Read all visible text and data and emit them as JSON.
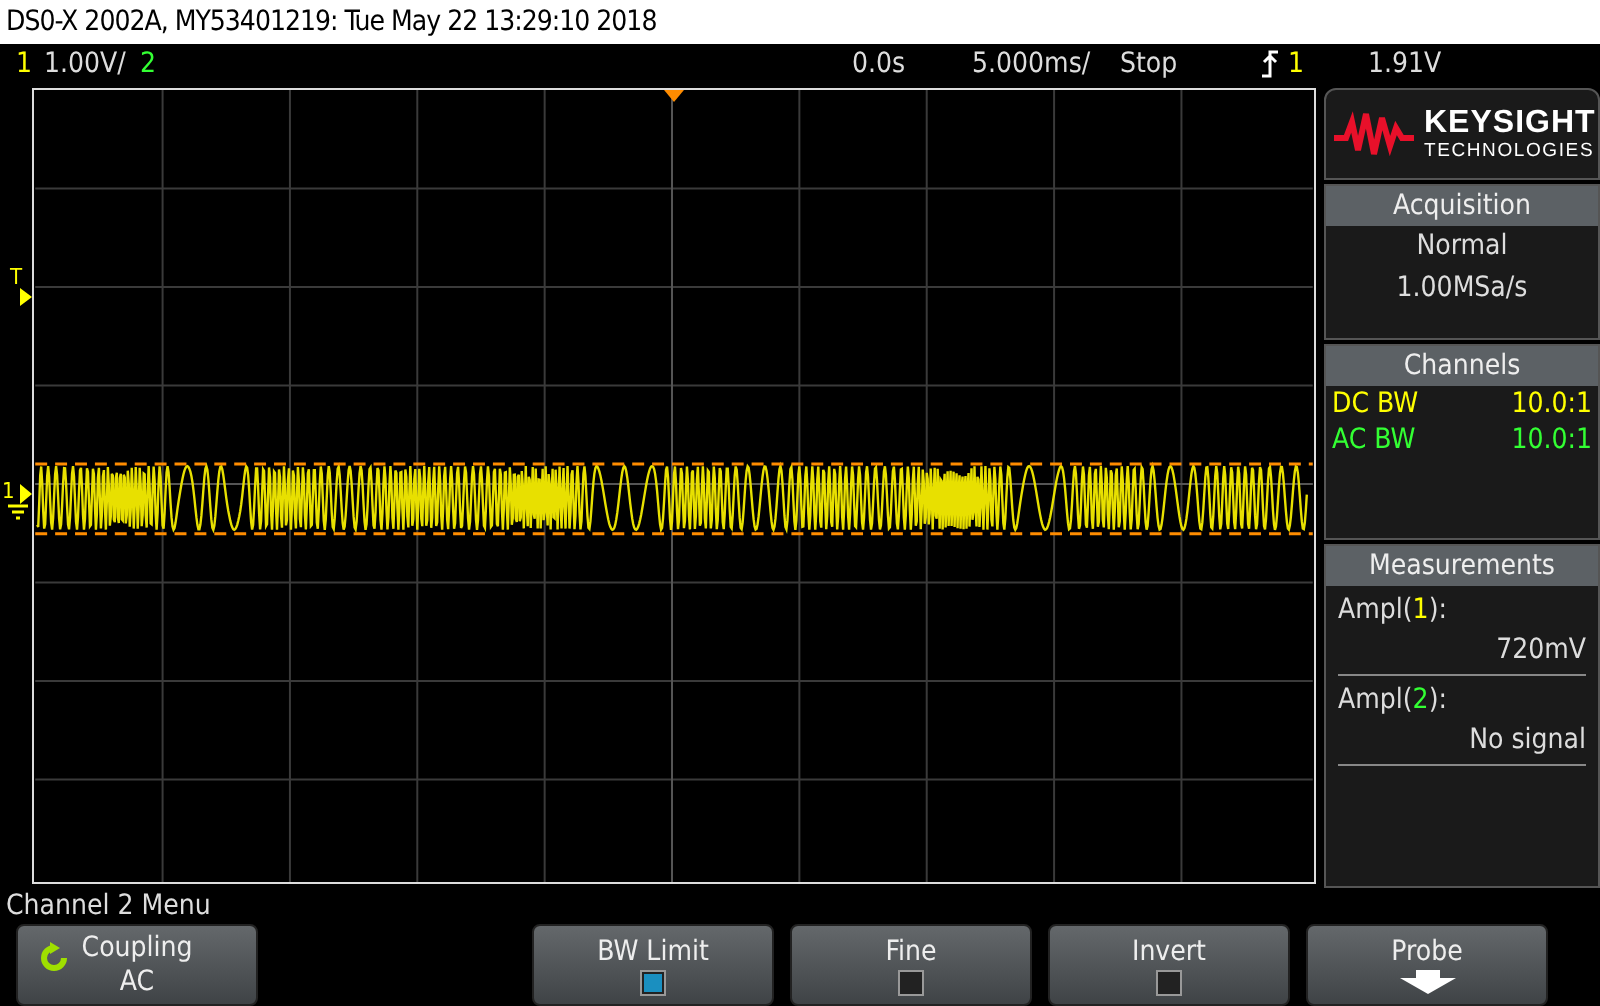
{
  "title": "DS0-X 2002A, MY53401219: Tue May 22 13:29:10 2018",
  "status": {
    "ch1": {
      "number": "1",
      "scale": "1.00V/",
      "color": "#ffff00"
    },
    "ch2": {
      "number": "2",
      "color": "#33ff33"
    },
    "delay": "0.0s",
    "timebase": "5.000ms/",
    "run_state": "Stop",
    "trigger": {
      "source": "1",
      "level": "1.91V"
    }
  },
  "markers": {
    "trigger": "T",
    "channel": "1"
  },
  "logo": {
    "name": "KEYSIGHT",
    "subtitle": "TECHNOLOGIES"
  },
  "acquisition": {
    "title": "Acquisition",
    "mode": "Normal",
    "rate": "1.00MSa/s"
  },
  "channels": {
    "title": "Channels",
    "rows": [
      {
        "label": "DC BW",
        "value": "10.0:1",
        "color": "#ffff00"
      },
      {
        "label": "AC BW",
        "value": "10.0:1",
        "color": "#33ff33"
      }
    ]
  },
  "measurements": {
    "title": "Measurements",
    "items": [
      {
        "name": "Ampl(",
        "channel": "1",
        "suffix": "):",
        "value": "720mV",
        "color": "#ffff00"
      },
      {
        "name": "Ampl(",
        "channel": "2",
        "suffix": "):",
        "value": "No signal",
        "color": "#33ff33"
      }
    ]
  },
  "menu": {
    "title": "Channel 2 Menu",
    "softkeys": [
      {
        "kind": "cycle",
        "label": "Coupling",
        "value": "AC"
      },
      {
        "kind": "blank"
      },
      {
        "kind": "checkbox",
        "label": "BW Limit",
        "checked": true
      },
      {
        "kind": "checkbox",
        "label": "Fine",
        "checked": false
      },
      {
        "kind": "checkbox",
        "label": "Invert",
        "checked": false
      },
      {
        "kind": "submenu",
        "label": "Probe"
      }
    ]
  }
}
